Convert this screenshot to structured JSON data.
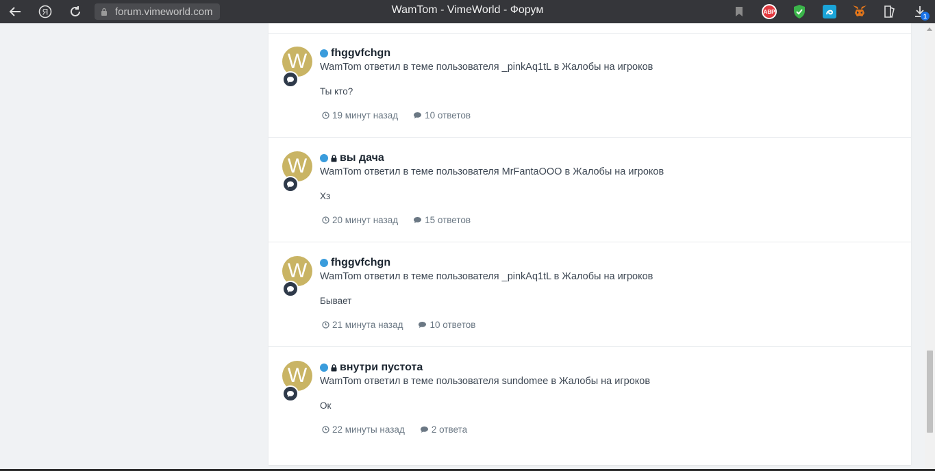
{
  "browser": {
    "url": "forum.vimeworld.com",
    "title": "WamTom - VimeWorld - Форум",
    "ext_abp": "ABP",
    "downloads_count": "1"
  },
  "colors": {
    "toolbar": "#35363a",
    "avatar": "#c9b464",
    "unread": "#3a9cdc",
    "badge": "#2f3a4a"
  },
  "items": [
    {
      "avatar_letter": "W",
      "locked": false,
      "title": "fhggvfchgn",
      "meta": "WamTom ответил в теме пользователя _pinkAq1tL в Жалобы на игроков",
      "snippet": "Ты кто?",
      "time": "19 минут назад",
      "replies": "10 ответов"
    },
    {
      "avatar_letter": "W",
      "locked": true,
      "title": "вы дача",
      "meta": "WamTom ответил в теме пользователя MrFantaOOO в Жалобы на игроков",
      "snippet": "Хз",
      "time": "20 минут назад",
      "replies": "15 ответов"
    },
    {
      "avatar_letter": "W",
      "locked": false,
      "title": "fhggvfchgn",
      "meta": "WamTom ответил в теме пользователя _pinkAq1tL в Жалобы на игроков",
      "snippet": "Бывает",
      "time": "21 минута назад",
      "replies": "10 ответов"
    },
    {
      "avatar_letter": "W",
      "locked": true,
      "title": "внутри пустота",
      "meta": "WamTom ответил в теме пользователя sundomee в Жалобы на игроков",
      "snippet": "Ок",
      "time": "22 минуты назад",
      "replies": "2 ответа"
    }
  ]
}
